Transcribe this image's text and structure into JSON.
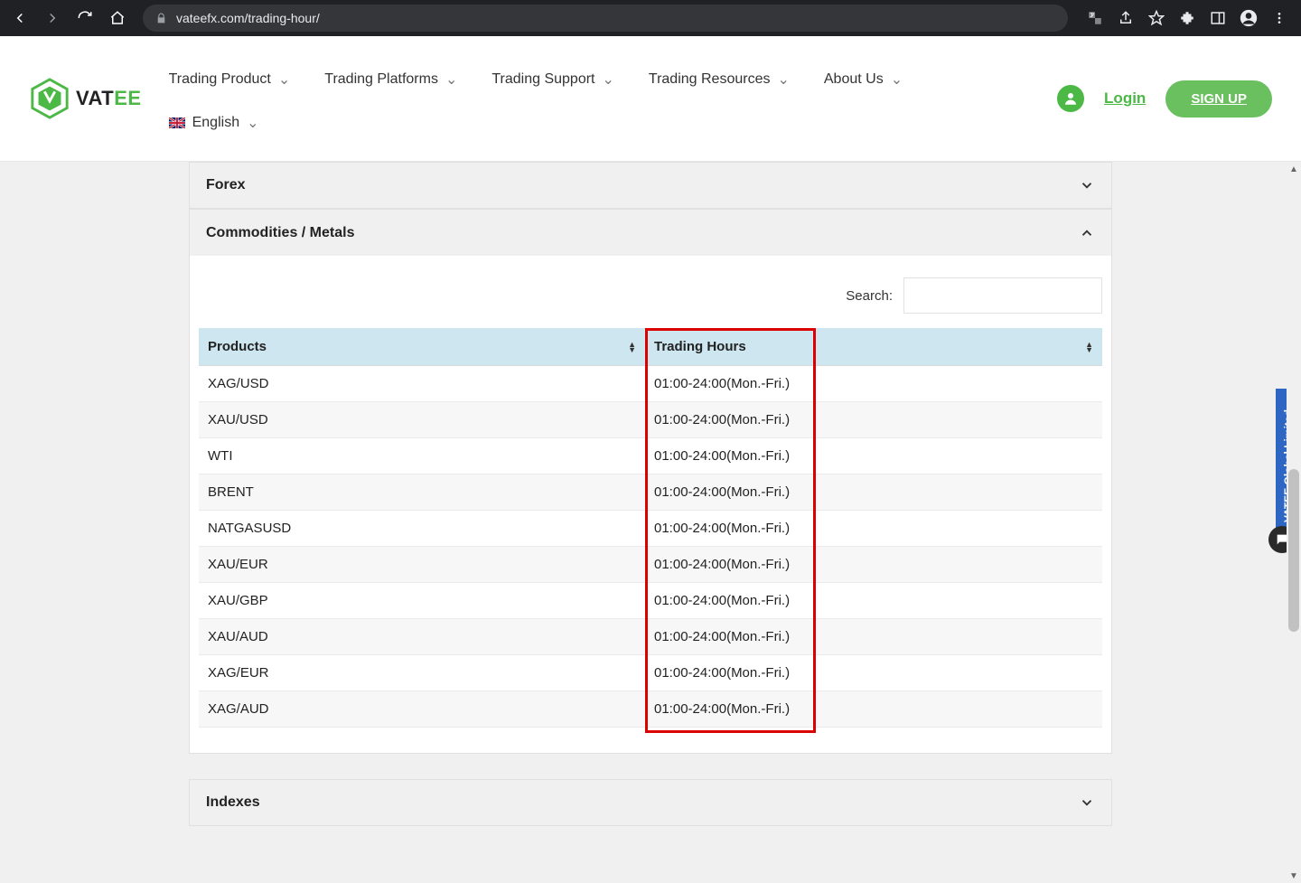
{
  "browser": {
    "url": "vateefx.com/trading-hour/"
  },
  "header": {
    "logo_text_before": "VAT",
    "logo_text_mid": "E",
    "logo_text_after": "E",
    "nav": [
      "Trading Product",
      "Trading Platforms",
      "Trading Support",
      "Trading Resources",
      "About Us"
    ],
    "lang_label": "English",
    "login": "Login",
    "signup": "SIGN UP"
  },
  "accordion": {
    "forex": "Forex",
    "commodities": "Commodities / Metals",
    "indexes": "Indexes"
  },
  "search_label": "Search:",
  "table": {
    "headers": [
      "Products",
      "Trading Hours"
    ],
    "rows": [
      {
        "product": "XAG/USD",
        "hours": "01:00-24:00(Mon.-Fri.)"
      },
      {
        "product": "XAU/USD",
        "hours": "01:00-24:00(Mon.-Fri.)"
      },
      {
        "product": "WTI",
        "hours": "01:00-24:00(Mon.-Fri.)"
      },
      {
        "product": "BRENT",
        "hours": "01:00-24:00(Mon.-Fri.)"
      },
      {
        "product": "NATGASUSD",
        "hours": "01:00-24:00(Mon.-Fri.)"
      },
      {
        "product": "XAU/EUR",
        "hours": "01:00-24:00(Mon.-Fri.)"
      },
      {
        "product": "XAU/GBP",
        "hours": "01:00-24:00(Mon.-Fri.)"
      },
      {
        "product": "XAU/AUD",
        "hours": "01:00-24:00(Mon.-Fri.)"
      },
      {
        "product": "XAG/EUR",
        "hours": "01:00-24:00(Mon.-Fri.)"
      },
      {
        "product": "XAG/AUD",
        "hours": "01:00-24:00(Mon.-Fri.)"
      }
    ]
  },
  "side_widget": "VATEE Global Limited"
}
